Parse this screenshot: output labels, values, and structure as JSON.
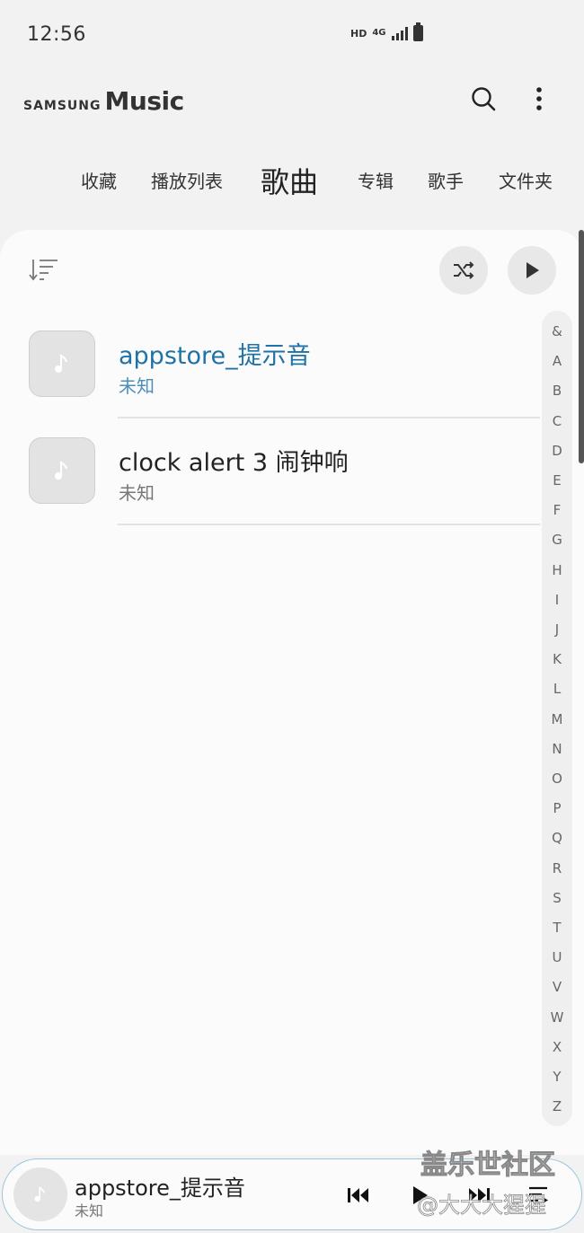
{
  "status_bar": {
    "time": "12:56",
    "hd": "HD",
    "network": "4G"
  },
  "header": {
    "brand_samsung": "SAMSUNG",
    "brand_music": "Music"
  },
  "tabs": [
    {
      "label": "收藏"
    },
    {
      "label": "播放列表"
    },
    {
      "label": "歌曲",
      "active": true
    },
    {
      "label": "专辑"
    },
    {
      "label": "歌手"
    },
    {
      "label": "文件夹"
    }
  ],
  "songs": [
    {
      "title": "appstore_提示音",
      "artist": "未知",
      "current": true
    },
    {
      "title": "clock alert 3 闹钟响",
      "artist": "未知",
      "current": false
    }
  ],
  "index_letters": [
    "&",
    "A",
    "B",
    "C",
    "D",
    "E",
    "F",
    "G",
    "H",
    "I",
    "J",
    "K",
    "L",
    "M",
    "N",
    "O",
    "P",
    "Q",
    "R",
    "S",
    "T",
    "U",
    "V",
    "W",
    "X",
    "Y",
    "Z"
  ],
  "mini_player": {
    "title": "appstore_提示音",
    "artist": "未知"
  },
  "watermark": {
    "line1": "盖乐世社区",
    "line2": "@大大大猩猩"
  },
  "colors": {
    "accent": "#1f72a6",
    "background": "#f2f2f2",
    "panel": "#fbfbfb"
  }
}
